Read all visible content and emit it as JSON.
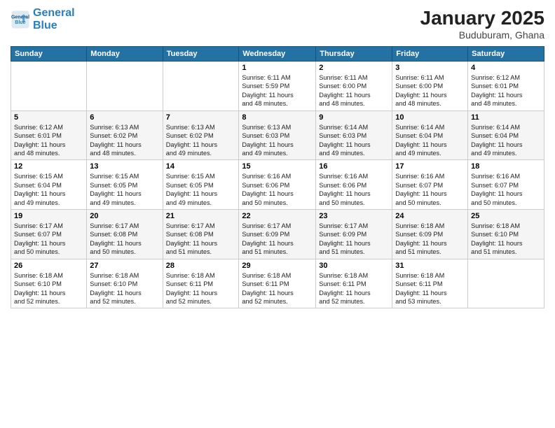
{
  "logo": {
    "line1": "General",
    "line2": "Blue"
  },
  "title": "January 2025",
  "subtitle": "Buduburam, Ghana",
  "weekdays": [
    "Sunday",
    "Monday",
    "Tuesday",
    "Wednesday",
    "Thursday",
    "Friday",
    "Saturday"
  ],
  "weeks": [
    [
      {
        "day": "",
        "info": ""
      },
      {
        "day": "",
        "info": ""
      },
      {
        "day": "",
        "info": ""
      },
      {
        "day": "1",
        "info": "Sunrise: 6:11 AM\nSunset: 5:59 PM\nDaylight: 11 hours\nand 48 minutes."
      },
      {
        "day": "2",
        "info": "Sunrise: 6:11 AM\nSunset: 6:00 PM\nDaylight: 11 hours\nand 48 minutes."
      },
      {
        "day": "3",
        "info": "Sunrise: 6:11 AM\nSunset: 6:00 PM\nDaylight: 11 hours\nand 48 minutes."
      },
      {
        "day": "4",
        "info": "Sunrise: 6:12 AM\nSunset: 6:01 PM\nDaylight: 11 hours\nand 48 minutes."
      }
    ],
    [
      {
        "day": "5",
        "info": "Sunrise: 6:12 AM\nSunset: 6:01 PM\nDaylight: 11 hours\nand 48 minutes."
      },
      {
        "day": "6",
        "info": "Sunrise: 6:13 AM\nSunset: 6:02 PM\nDaylight: 11 hours\nand 48 minutes."
      },
      {
        "day": "7",
        "info": "Sunrise: 6:13 AM\nSunset: 6:02 PM\nDaylight: 11 hours\nand 49 minutes."
      },
      {
        "day": "8",
        "info": "Sunrise: 6:13 AM\nSunset: 6:03 PM\nDaylight: 11 hours\nand 49 minutes."
      },
      {
        "day": "9",
        "info": "Sunrise: 6:14 AM\nSunset: 6:03 PM\nDaylight: 11 hours\nand 49 minutes."
      },
      {
        "day": "10",
        "info": "Sunrise: 6:14 AM\nSunset: 6:04 PM\nDaylight: 11 hours\nand 49 minutes."
      },
      {
        "day": "11",
        "info": "Sunrise: 6:14 AM\nSunset: 6:04 PM\nDaylight: 11 hours\nand 49 minutes."
      }
    ],
    [
      {
        "day": "12",
        "info": "Sunrise: 6:15 AM\nSunset: 6:04 PM\nDaylight: 11 hours\nand 49 minutes."
      },
      {
        "day": "13",
        "info": "Sunrise: 6:15 AM\nSunset: 6:05 PM\nDaylight: 11 hours\nand 49 minutes."
      },
      {
        "day": "14",
        "info": "Sunrise: 6:15 AM\nSunset: 6:05 PM\nDaylight: 11 hours\nand 49 minutes."
      },
      {
        "day": "15",
        "info": "Sunrise: 6:16 AM\nSunset: 6:06 PM\nDaylight: 11 hours\nand 50 minutes."
      },
      {
        "day": "16",
        "info": "Sunrise: 6:16 AM\nSunset: 6:06 PM\nDaylight: 11 hours\nand 50 minutes."
      },
      {
        "day": "17",
        "info": "Sunrise: 6:16 AM\nSunset: 6:07 PM\nDaylight: 11 hours\nand 50 minutes."
      },
      {
        "day": "18",
        "info": "Sunrise: 6:16 AM\nSunset: 6:07 PM\nDaylight: 11 hours\nand 50 minutes."
      }
    ],
    [
      {
        "day": "19",
        "info": "Sunrise: 6:17 AM\nSunset: 6:07 PM\nDaylight: 11 hours\nand 50 minutes."
      },
      {
        "day": "20",
        "info": "Sunrise: 6:17 AM\nSunset: 6:08 PM\nDaylight: 11 hours\nand 50 minutes."
      },
      {
        "day": "21",
        "info": "Sunrise: 6:17 AM\nSunset: 6:08 PM\nDaylight: 11 hours\nand 51 minutes."
      },
      {
        "day": "22",
        "info": "Sunrise: 6:17 AM\nSunset: 6:09 PM\nDaylight: 11 hours\nand 51 minutes."
      },
      {
        "day": "23",
        "info": "Sunrise: 6:17 AM\nSunset: 6:09 PM\nDaylight: 11 hours\nand 51 minutes."
      },
      {
        "day": "24",
        "info": "Sunrise: 6:18 AM\nSunset: 6:09 PM\nDaylight: 11 hours\nand 51 minutes."
      },
      {
        "day": "25",
        "info": "Sunrise: 6:18 AM\nSunset: 6:10 PM\nDaylight: 11 hours\nand 51 minutes."
      }
    ],
    [
      {
        "day": "26",
        "info": "Sunrise: 6:18 AM\nSunset: 6:10 PM\nDaylight: 11 hours\nand 52 minutes."
      },
      {
        "day": "27",
        "info": "Sunrise: 6:18 AM\nSunset: 6:10 PM\nDaylight: 11 hours\nand 52 minutes."
      },
      {
        "day": "28",
        "info": "Sunrise: 6:18 AM\nSunset: 6:11 PM\nDaylight: 11 hours\nand 52 minutes."
      },
      {
        "day": "29",
        "info": "Sunrise: 6:18 AM\nSunset: 6:11 PM\nDaylight: 11 hours\nand 52 minutes."
      },
      {
        "day": "30",
        "info": "Sunrise: 6:18 AM\nSunset: 6:11 PM\nDaylight: 11 hours\nand 52 minutes."
      },
      {
        "day": "31",
        "info": "Sunrise: 6:18 AM\nSunset: 6:11 PM\nDaylight: 11 hours\nand 53 minutes."
      },
      {
        "day": "",
        "info": ""
      }
    ]
  ]
}
